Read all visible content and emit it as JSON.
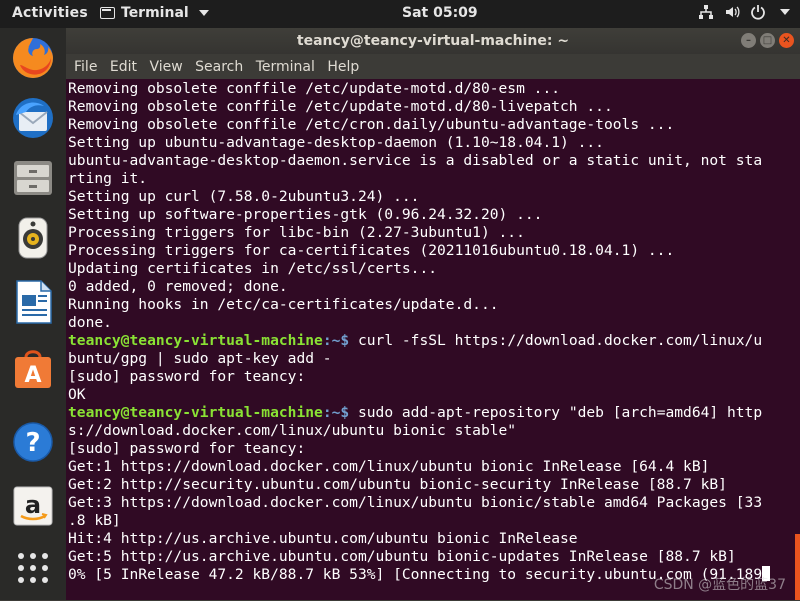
{
  "topbar": {
    "activities": "Activities",
    "app_menu": "Terminal",
    "clock": "Sat 05:09"
  },
  "dock": {
    "items": [
      {
        "name": "firefox-icon",
        "active": false
      },
      {
        "name": "thunderbird-icon",
        "active": false
      },
      {
        "name": "files-icon",
        "active": false
      },
      {
        "name": "rhythmbox-icon",
        "active": false
      },
      {
        "name": "libreoffice-writer-icon",
        "active": false
      },
      {
        "name": "ubuntu-software-icon",
        "active": false
      },
      {
        "name": "help-icon",
        "active": false
      },
      {
        "name": "amazon-icon",
        "active": false
      },
      {
        "name": "show-applications-icon",
        "active": false
      }
    ]
  },
  "window": {
    "title": "teancy@teancy-virtual-machine: ~",
    "menu": [
      "File",
      "Edit",
      "View",
      "Search",
      "Terminal",
      "Help"
    ]
  },
  "terminal": {
    "prompt_user": "teancy@teancy-virtual-machine",
    "prompt_path": ":~$",
    "lines": [
      {
        "text": "Removing obsolete conffile /etc/update-motd.d/80-esm ..."
      },
      {
        "text": "Removing obsolete conffile /etc/update-motd.d/80-livepatch ..."
      },
      {
        "text": "Removing obsolete conffile /etc/cron.daily/ubuntu-advantage-tools ..."
      },
      {
        "text": "Setting up ubuntu-advantage-desktop-daemon (1.10~18.04.1) ..."
      },
      {
        "text": "ubuntu-advantage-desktop-daemon.service is a disabled or a static unit, not sta"
      },
      {
        "text": "rting it."
      },
      {
        "text": "Setting up curl (7.58.0-2ubuntu3.24) ..."
      },
      {
        "text": "Setting up software-properties-gtk (0.96.24.32.20) ..."
      },
      {
        "text": "Processing triggers for libc-bin (2.27-3ubuntu1) ..."
      },
      {
        "text": "Processing triggers for ca-certificates (20211016ubuntu0.18.04.1) ..."
      },
      {
        "text": "Updating certificates in /etc/ssl/certs..."
      },
      {
        "text": "0 added, 0 removed; done."
      },
      {
        "text": "Running hooks in /etc/ca-certificates/update.d..."
      },
      {
        "text": "done."
      },
      {
        "prompt": true,
        "text": " curl -fsSL https://download.docker.com/linux/u"
      },
      {
        "text": "buntu/gpg | sudo apt-key add -"
      },
      {
        "text": "[sudo] password for teancy:"
      },
      {
        "text": "OK"
      },
      {
        "prompt": true,
        "text": " sudo add-apt-repository \"deb [arch=amd64] http"
      },
      {
        "text": "s://download.docker.com/linux/ubuntu bionic stable\""
      },
      {
        "text": "[sudo] password for teancy:"
      },
      {
        "text": "Get:1 https://download.docker.com/linux/ubuntu bionic InRelease [64.4 kB]"
      },
      {
        "text": "Get:2 http://security.ubuntu.com/ubuntu bionic-security InRelease [88.7 kB]"
      },
      {
        "text": "Get:3 https://download.docker.com/linux/ubuntu bionic/stable amd64 Packages [33"
      },
      {
        "text": ".8 kB]"
      },
      {
        "text": "Hit:4 http://us.archive.ubuntu.com/ubuntu bionic InRelease"
      },
      {
        "text": "Get:5 http://us.archive.ubuntu.com/ubuntu bionic-updates InRelease [88.7 kB]"
      },
      {
        "text": "0% [5 InRelease 47.2 kB/88.7 kB 53%] [Connecting to security.ubuntu.com (91.189",
        "cursor": true
      }
    ]
  },
  "watermark": "CSDN @蓝色的蓝37",
  "colors": {
    "terminal_bg": "#300a24",
    "prompt_user": "#8ae234",
    "prompt_path": "#729fcf",
    "accent": "#e9541f"
  }
}
